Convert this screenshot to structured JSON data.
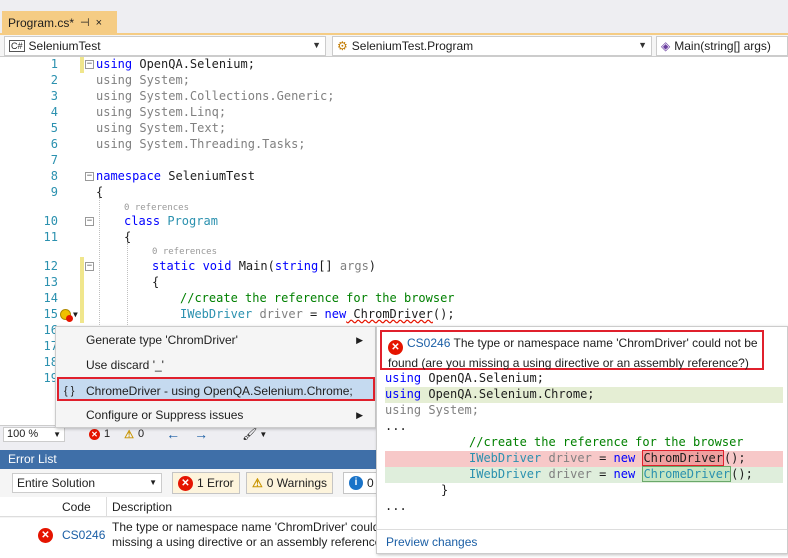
{
  "tab": {
    "title": "Program.cs*",
    "pin": "⊣",
    "close": "×"
  },
  "nav": {
    "project": "SeleniumTest",
    "class": "SeleniumTest.Program",
    "member": "Main(string[] args)"
  },
  "editor": {
    "line_numbers": [
      "1",
      "2",
      "3",
      "4",
      "5",
      "6",
      "7",
      "8",
      "9",
      "10",
      "11",
      "12",
      "13",
      "14",
      "15",
      "16",
      "17",
      "18",
      "19"
    ],
    "refs": [
      "0 references",
      "0 references"
    ],
    "zoom": "100 %",
    "errors": "1",
    "warnings": "0"
  },
  "code": {
    "l1_kw": "using",
    "l1_ns": " OpenQA.Selenium;",
    "l2": "using System;",
    "l3": "using System.Collections.Generic;",
    "l4": "using System.Linq;",
    "l5": "using System.Text;",
    "l6": "using System.Threading.Tasks;",
    "l8_kw": "namespace",
    "l8_name": " SeleniumTest",
    "l9": "{",
    "l10_kw": "class",
    "l10_name": "Program",
    "l11": "{",
    "l12_kw": "static void",
    "l12_name": " Main(",
    "l12_kw2": "string",
    "l12_rest": "[] ",
    "l12_arg": "args",
    "l12_end": ")",
    "l13": "{",
    "l14": "//create the reference for the browser",
    "l15_type": "IWebDriver",
    "l15_var": " driver",
    "l15_eq": " = ",
    "l15_kw": "new",
    "l15_cls": " ChromDriver",
    "l15_end": "();"
  },
  "quick_actions": [
    {
      "label": "Generate type 'ChromDriver'",
      "submenu": "▶"
    },
    {
      "label": "Use discard '_'",
      "submenu": ""
    },
    {
      "label": "ChromeDriver - using OpenQA.Selenium.Chrome;",
      "submenu": "▶",
      "icon": "{ }"
    },
    {
      "label": "Configure or Suppress issues",
      "submenu": "▶"
    }
  ],
  "preview": {
    "error_code": "CS0246",
    "error_text": "The type or namespace name 'ChromDriver' could not be found (are you missing a using directive or an assembly reference?)",
    "lines": [
      "using OpenQA.Selenium;",
      "using OpenQA.Selenium.Chrome;",
      "using System;",
      "...",
      "//create the reference for the browser",
      "IWebDriver driver = new ChromDriver();",
      "IWebDriver driver = new ChromeDriver();",
      "}",
      "..."
    ],
    "link": "Preview changes"
  },
  "error_list": {
    "title": "Error List",
    "scope": "Entire Solution",
    "errors_btn": "1 Error",
    "warnings_btn": "0 Warnings",
    "info_btn": "0",
    "col_code": "Code",
    "col_desc": "Description",
    "row_code": "CS0246",
    "row_desc_1": "The type or namespace name 'ChromDriver' could",
    "row_desc_2": "missing a using directive or an assembly reference"
  },
  "colors": {
    "accent": "#f5cc84",
    "error": "#e51400",
    "keyword": "#0000ff",
    "type": "#2b91af",
    "comment": "#008000"
  }
}
